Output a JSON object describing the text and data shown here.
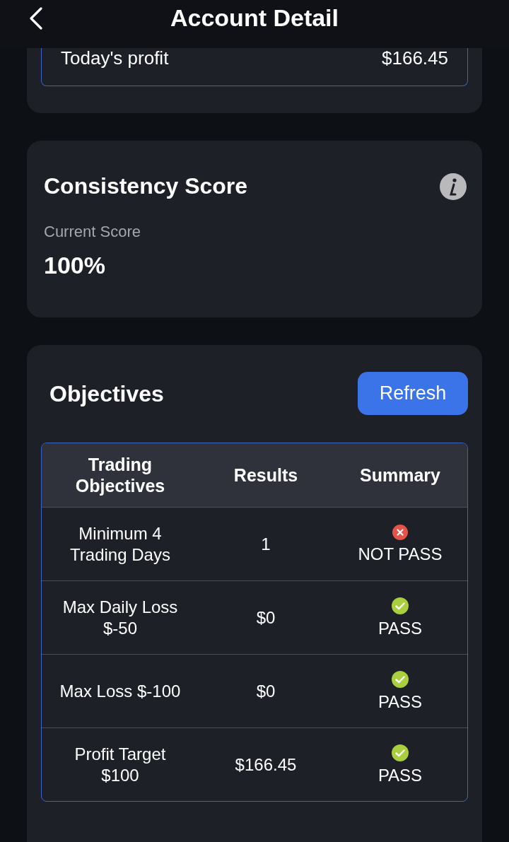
{
  "header": {
    "title": "Account Detail"
  },
  "profit": {
    "label": "Today's profit",
    "value": "$166.45"
  },
  "consistency": {
    "title": "Consistency Score",
    "score_label": "Current Score",
    "score": "100%"
  },
  "objectives": {
    "title": "Objectives",
    "refresh_button": "Refresh",
    "table": {
      "columns": [
        "Trading Objectives",
        "Results",
        "Summary"
      ],
      "rows": [
        {
          "objective": "Minimum 4 Trading Days",
          "result": "1",
          "kind": "fail",
          "summary": "NOT PASS"
        },
        {
          "objective": "Max Daily Loss $-50",
          "result": "$0",
          "kind": "pass",
          "summary": "PASS"
        },
        {
          "objective": "Max Loss $-100",
          "result": "$0",
          "kind": "pass",
          "summary": "PASS"
        },
        {
          "objective": "Profit Target $100",
          "result": "$166.45",
          "kind": "pass",
          "summary": "PASS"
        }
      ]
    }
  }
}
